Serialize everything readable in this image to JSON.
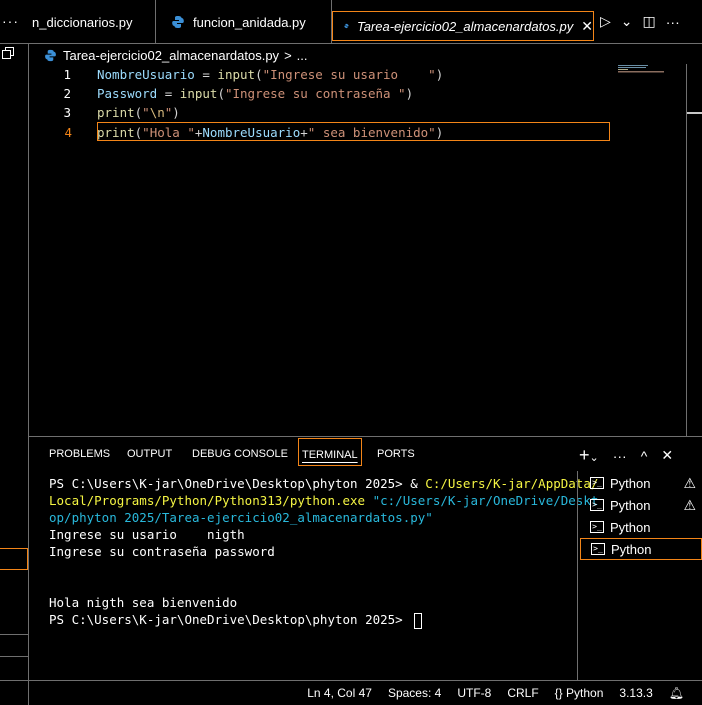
{
  "tabs": [
    {
      "label": "n_diccionarios.py",
      "active": false
    },
    {
      "label": "funcion_anidada.py",
      "active": false
    },
    {
      "label": "Tarea-ejercicio02_almacenardatos.py",
      "active": true
    }
  ],
  "tab_overflow": "···",
  "tab_actions": {
    "run": "▷",
    "run_menu": "⌄",
    "split": "◫",
    "more": "···"
  },
  "breadcrumb": {
    "file": "Tarea-ejercicio02_almacenardatos.py",
    "separator": ">",
    "more": "..."
  },
  "editor": {
    "current_line": 4,
    "lines": [
      {
        "number": "1",
        "tokens": [
          {
            "t": "NombreUsuario",
            "k": "var"
          },
          {
            "t": " = ",
            "k": "plain"
          },
          {
            "t": "input",
            "k": "fn"
          },
          {
            "t": "(",
            "k": "plain"
          },
          {
            "t": "\"Ingrese su usario    \"",
            "k": "str"
          },
          {
            "t": ")",
            "k": "plain"
          }
        ]
      },
      {
        "number": "2",
        "tokens": [
          {
            "t": "Password",
            "k": "var"
          },
          {
            "t": " = ",
            "k": "plain"
          },
          {
            "t": "input",
            "k": "fn"
          },
          {
            "t": "(",
            "k": "plain"
          },
          {
            "t": "\"Ingrese su contraseña \"",
            "k": "str"
          },
          {
            "t": ")",
            "k": "plain"
          }
        ]
      },
      {
        "number": "3",
        "tokens": [
          {
            "t": "print",
            "k": "fn"
          },
          {
            "t": "(",
            "k": "plain"
          },
          {
            "t": "\"",
            "k": "str"
          },
          {
            "t": "\\n",
            "k": "esc"
          },
          {
            "t": "\"",
            "k": "str"
          },
          {
            "t": ")",
            "k": "plain"
          }
        ]
      },
      {
        "number": "4",
        "tokens": [
          {
            "t": "print",
            "k": "fn"
          },
          {
            "t": "(",
            "k": "plain"
          },
          {
            "t": "\"Hola \"",
            "k": "str"
          },
          {
            "t": "+",
            "k": "plain"
          },
          {
            "t": "NombreUsuario",
            "k": "var"
          },
          {
            "t": "+",
            "k": "plain"
          },
          {
            "t": "\" sea bienvenido\"",
            "k": "str"
          },
          {
            "t": ")",
            "k": "plain"
          }
        ]
      }
    ]
  },
  "panel": {
    "tabs": [
      "PROBLEMS",
      "OUTPUT",
      "DEBUG CONSOLE",
      "TERMINAL",
      "PORTS"
    ],
    "active_tab": "TERMINAL",
    "actions": {
      "add": "+",
      "add_menu": "⌄",
      "more": "···",
      "maximize": "^",
      "close": "✕"
    }
  },
  "terminal": {
    "lines": [
      [
        {
          "t": "PS C:\\Users\\K-jar\\OneDrive\\Desktop\\phyton 2025> & ",
          "k": "w"
        },
        {
          "t": "C:/Users/K-jar/AppData/",
          "k": "y"
        }
      ],
      [
        {
          "t": "Local/Programs/Python/Python313/python.exe ",
          "k": "y"
        },
        {
          "t": "\"c:/Users/K-jar/OneDrive/Deskt",
          "k": "c"
        }
      ],
      [
        {
          "t": "op/phyton 2025/Tarea-ejercicio02_almacenardatos.py\"",
          "k": "c"
        }
      ],
      [
        {
          "t": "Ingrese su usario    nigth",
          "k": "w"
        }
      ],
      [
        {
          "t": "Ingrese su contraseña password",
          "k": "w"
        }
      ],
      [
        {
          "t": "",
          "k": "w"
        }
      ],
      [
        {
          "t": "",
          "k": "w"
        }
      ],
      [
        {
          "t": "Hola nigth sea bienvenido",
          "k": "w"
        }
      ],
      [
        {
          "t": "PS C:\\Users\\K-jar\\OneDrive\\Desktop\\phyton 2025> ",
          "k": "w"
        }
      ]
    ],
    "instances": [
      {
        "label": "Python",
        "warning": true,
        "selected": false
      },
      {
        "label": "Python",
        "warning": true,
        "selected": false
      },
      {
        "label": "Python",
        "warning": false,
        "selected": false
      },
      {
        "label": "Python",
        "warning": false,
        "selected": true
      }
    ]
  },
  "statusbar": {
    "position": "Ln 4, Col 47",
    "spaces": "Spaces: 4",
    "encoding": "UTF-8",
    "eol": "CRLF",
    "language": "Python",
    "language_icon": "{}",
    "version": "3.13.3",
    "bell_icon": "bell-icon"
  },
  "colors": {
    "accent": "#f38518",
    "border": "#6f6f6f",
    "var": "#9cdcfe",
    "fn": "#dcdcaa",
    "str": "#ce9178"
  }
}
